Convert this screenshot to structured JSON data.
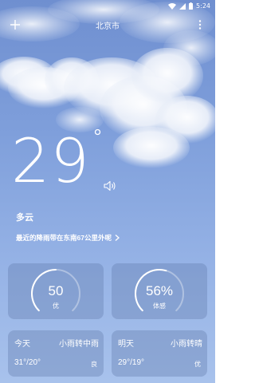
{
  "status_bar": {
    "time": "5:24",
    "icons": [
      "wifi-icon",
      "signal-icon",
      "battery-icon"
    ]
  },
  "header": {
    "city": "北京市",
    "add_icon": "plus-icon",
    "menu_icon": "more-vert-icon"
  },
  "current": {
    "temperature": "29",
    "condition": "多云",
    "rain_notice": "最近的降雨带在东南67公里外呢",
    "speaker_icon": "speaker-icon"
  },
  "gauges": [
    {
      "value": "50",
      "label": "优",
      "level": 0.5
    },
    {
      "value": "56%",
      "label": "体感",
      "level": 0.56
    }
  ],
  "forecast": [
    {
      "day": "今天",
      "weather": "小雨转中雨",
      "temps": "31°/20°",
      "aq": "良"
    },
    {
      "day": "明天",
      "weather": "小雨转晴",
      "temps": "29°/19°",
      "aq": "优"
    }
  ],
  "colors": {
    "sky_top": "#6f8fd0",
    "sky_bottom": "#a8c2ec",
    "card_bg": "rgba(95,120,170,0.35)",
    "text": "#ffffff"
  }
}
